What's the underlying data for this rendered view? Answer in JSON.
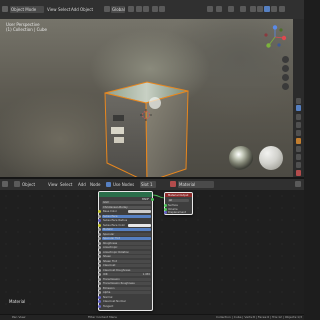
{
  "header": {
    "mode": "Object Mode",
    "menus": [
      "View",
      "Select",
      "Add",
      "Object"
    ],
    "transform": "Global"
  },
  "viewport": {
    "view_name": "User Perspective",
    "collection": "(1) Collection | Cube"
  },
  "node_header": {
    "editor_type": "Object",
    "menus": [
      "View",
      "Select",
      "Add",
      "Node"
    ],
    "use_nodes": "Use Nodes",
    "slot": "Slot 1",
    "material": "Material"
  },
  "bsdf_node": {
    "title": "BSDF",
    "rows": [
      "GGX",
      "Christensen-Burley",
      "Base Color",
      "Subsurface",
      "Subsurface Radius",
      "Subsurface Color",
      "Metallic",
      "Specular",
      "Specular Tint",
      "Roughness",
      "Anisotropic",
      "Anisotropic Rotation",
      "Sheen",
      "Sheen Tint",
      "Clearcoat",
      "Clearcoat Roughness",
      "IOR",
      "Transmission",
      "Transmission Roughness",
      "Emission",
      "Alpha",
      "Normal",
      "Clearcoat Normal",
      "Tangent"
    ],
    "ior_value": "1.450"
  },
  "output_node": {
    "title": "Material Output",
    "option": "All",
    "rows": [
      "Surface",
      "Volume",
      "Displacement"
    ]
  },
  "material_label": "Material",
  "status": {
    "left": "Pan View",
    "middle": "Filter Context Menu",
    "right": "Collection | Cube | Verts:8 | Faces:6 | Tris:12 | Objects:1/3"
  },
  "colors": {
    "header_bg": "#303030",
    "node_header_green": "#2a6e4a",
    "node_header_red": "#8e2a2a",
    "selection_orange": "#e8871e",
    "socket_yellow": "#c7c729",
    "socket_purple": "#6363c7",
    "socket_grey": "#a1a1a1",
    "socket_green": "#4ec75a"
  }
}
